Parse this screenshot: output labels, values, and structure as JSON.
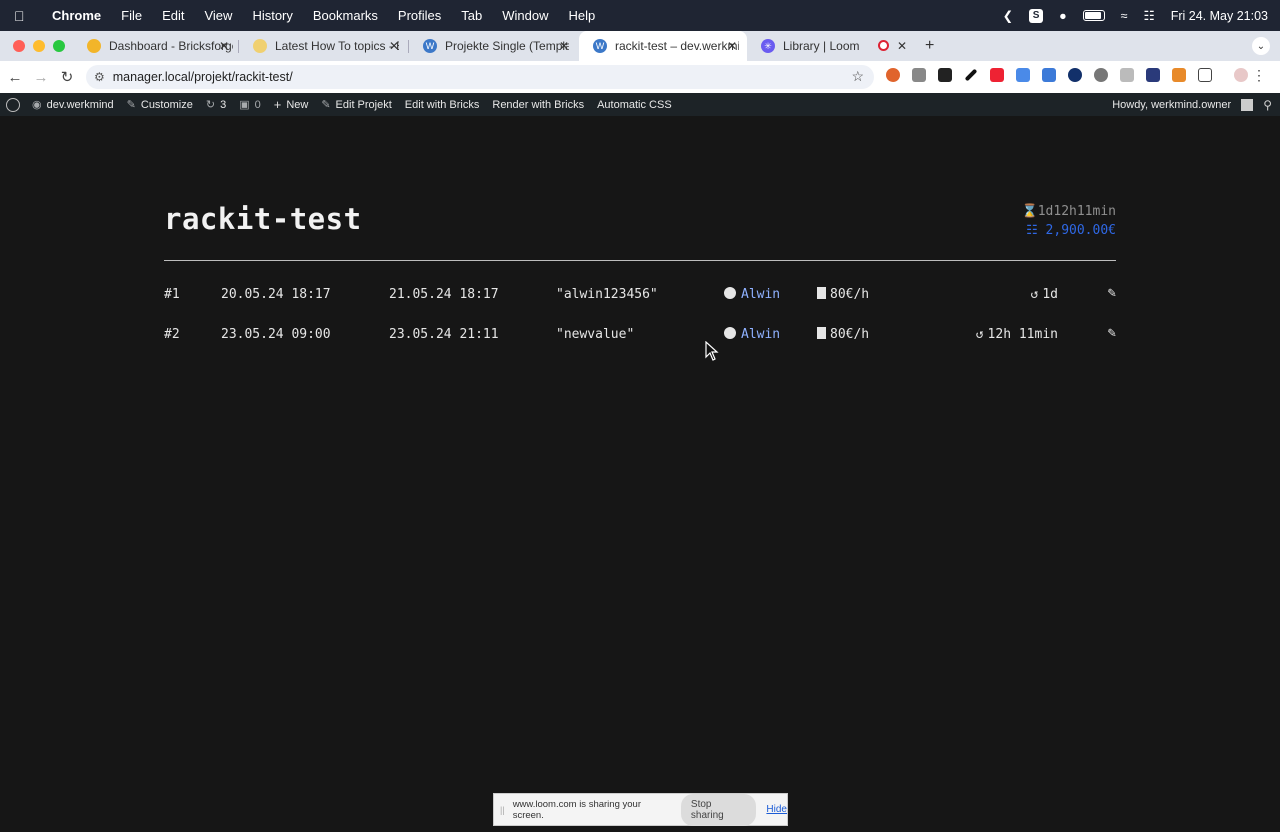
{
  "menubar": {
    "apple": "",
    "app": "Chrome",
    "items": [
      "File",
      "Edit",
      "View",
      "History",
      "Bookmarks",
      "Profiles",
      "Tab",
      "Window",
      "Help"
    ],
    "datetime": "Fri 24. May  21:03"
  },
  "tabs": [
    {
      "label": "Dashboard - Bricksforge – Th",
      "favicon_color": "#f2b52a",
      "active": false
    },
    {
      "label": "Latest How To topics - Bricks",
      "favicon_color": "#f0d070",
      "active": false
    },
    {
      "label": "Projekte Single (Template)",
      "favicon_color": "#3c78c8",
      "active": false
    },
    {
      "label": "rackit-test – dev.werkmind",
      "favicon_color": "#3c78c8",
      "active": true
    },
    {
      "label": "Library | Loom",
      "favicon_color": "#6a5bf0",
      "active": false
    }
  ],
  "toolbar": {
    "url": "manager.local/projekt/rackit-test/"
  },
  "adminbar": {
    "site": "dev.werkmind",
    "customize": "Customize",
    "updates": "3",
    "comments": "0",
    "new": "New",
    "edit_projekt": "Edit Projekt",
    "edit_bricks": "Edit with Bricks",
    "render_bricks": "Render with Bricks",
    "automatic_css": "Automatic CSS",
    "howdy": "Howdy, werkmind.owner"
  },
  "project": {
    "title": "rackit-test",
    "total_duration": "1d12h11min",
    "total_cost": "2,900.00€"
  },
  "entries": [
    {
      "num": "#1",
      "start": "20.05.24 18:17",
      "end": "21.05.24 18:17",
      "value": "\"alwin123456\"",
      "user": "Alwin",
      "rate": "80€/h",
      "duration": "1d"
    },
    {
      "num": "#2",
      "start": "23.05.24 09:00",
      "end": "23.05.24 21:11",
      "value": "\"newvalue\"",
      "user": "Alwin",
      "rate": "80€/h",
      "duration": "12h 11min"
    }
  ],
  "loom_bar": {
    "message": "www.loom.com is sharing your screen.",
    "stop_label": "Stop sharing",
    "hide_label": "Hide"
  },
  "colors": {
    "accent_blue": "#2f68e5",
    "user_link": "#8fb1ff",
    "background": "#161616"
  }
}
